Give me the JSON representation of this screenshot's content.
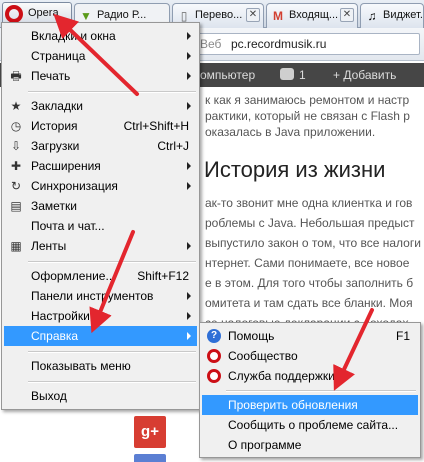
{
  "tabbar": {
    "opera_label": "Opera",
    "tabs": [
      {
        "label": "Радио Р...",
        "icon": "radio-icon"
      },
      {
        "label": "Перево...",
        "icon": "page-icon"
      },
      {
        "label": "Входящ...",
        "icon": "gmail-icon"
      },
      {
        "label": "Виджет...",
        "icon": "music-note-icon"
      }
    ],
    "close_glyph": "✕"
  },
  "address": {
    "prefix": "Веб",
    "url": "pc.recordmusik.ru"
  },
  "page": {
    "toolbar_computer": "омпьютер",
    "toolbar_comments": "1",
    "toolbar_add": "+ Добавить",
    "lines_top": [
      "к как я занимаюсь ремонтом и настр",
      "рактики, который не связан с Flash р",
      "оказалась в Java приложении."
    ],
    "heading": "История из жизни",
    "lines_body": [
      "ак-то звонит мне одна клиентка и гов",
      "роблемы с Java. Небольшая предыст",
      "выпустило закон о том, что все налоги",
      "нтернет. Сами понимаете, все новое",
      "е в этом. Для того чтобы заполнить б",
      "омитета  и там сдать все бланки. Моя",
      "се налоговые декларации с доходах."
    ],
    "gplus_label": "g+"
  },
  "main_menu": {
    "items": [
      {
        "label": "Вкладки и окна",
        "icon": "",
        "shortcut": "",
        "submenu": true
      },
      {
        "label": "Страница",
        "icon": "",
        "shortcut": "",
        "submenu": true
      },
      {
        "label": "Печать",
        "icon": "printer-icon",
        "shortcut": "",
        "submenu": true
      },
      {
        "label": "Закладки",
        "icon": "star-icon",
        "shortcut": "",
        "submenu": true
      },
      {
        "label": "История",
        "icon": "clock-icon",
        "shortcut": "Ctrl+Shift+H",
        "submenu": false
      },
      {
        "label": "Загрузки",
        "icon": "download-icon",
        "shortcut": "Ctrl+J",
        "submenu": false
      },
      {
        "label": "Расширения",
        "icon": "puzzle-icon",
        "shortcut": "",
        "submenu": true
      },
      {
        "label": "Синхронизация",
        "icon": "sync-icon",
        "shortcut": "",
        "submenu": true
      },
      {
        "label": "Заметки",
        "icon": "note-icon",
        "shortcut": "",
        "submenu": false
      },
      {
        "label": "Почта и чат...",
        "icon": "",
        "shortcut": "",
        "submenu": false
      },
      {
        "label": "Ленты",
        "icon": "rss-icon",
        "shortcut": "",
        "submenu": true
      },
      {
        "label": "Оформление...",
        "icon": "",
        "shortcut": "Shift+F12",
        "submenu": false
      },
      {
        "label": "Панели инструментов",
        "icon": "",
        "shortcut": "",
        "submenu": true
      },
      {
        "label": "Настройки",
        "icon": "",
        "shortcut": "",
        "submenu": true
      },
      {
        "label": "Справка",
        "icon": "",
        "shortcut": "",
        "submenu": true
      },
      {
        "label": "Показывать меню",
        "icon": "",
        "shortcut": "",
        "submenu": false
      },
      {
        "label": "Выход",
        "icon": "",
        "shortcut": "",
        "submenu": false
      }
    ],
    "highlighted": "Справка"
  },
  "help_submenu": {
    "items": [
      {
        "label": "Помощь",
        "icon": "help-icon",
        "shortcut": "F1"
      },
      {
        "label": "Сообщество",
        "icon": "opera-icon",
        "shortcut": ""
      },
      {
        "label": "Служба поддержки",
        "icon": "opera-icon",
        "shortcut": ""
      },
      {
        "label": "Проверить обновления",
        "icon": "",
        "shortcut": ""
      },
      {
        "label": "Сообщить о проблеме сайта...",
        "icon": "",
        "shortcut": ""
      },
      {
        "label": "О программе",
        "icon": "",
        "shortcut": ""
      }
    ],
    "highlighted": "Проверить обновления"
  },
  "colors": {
    "highlight": "#3399ff",
    "opera_red": "#cc0f16",
    "annotation_arrow": "#e3262e",
    "wp_toolbar": "#464646"
  }
}
